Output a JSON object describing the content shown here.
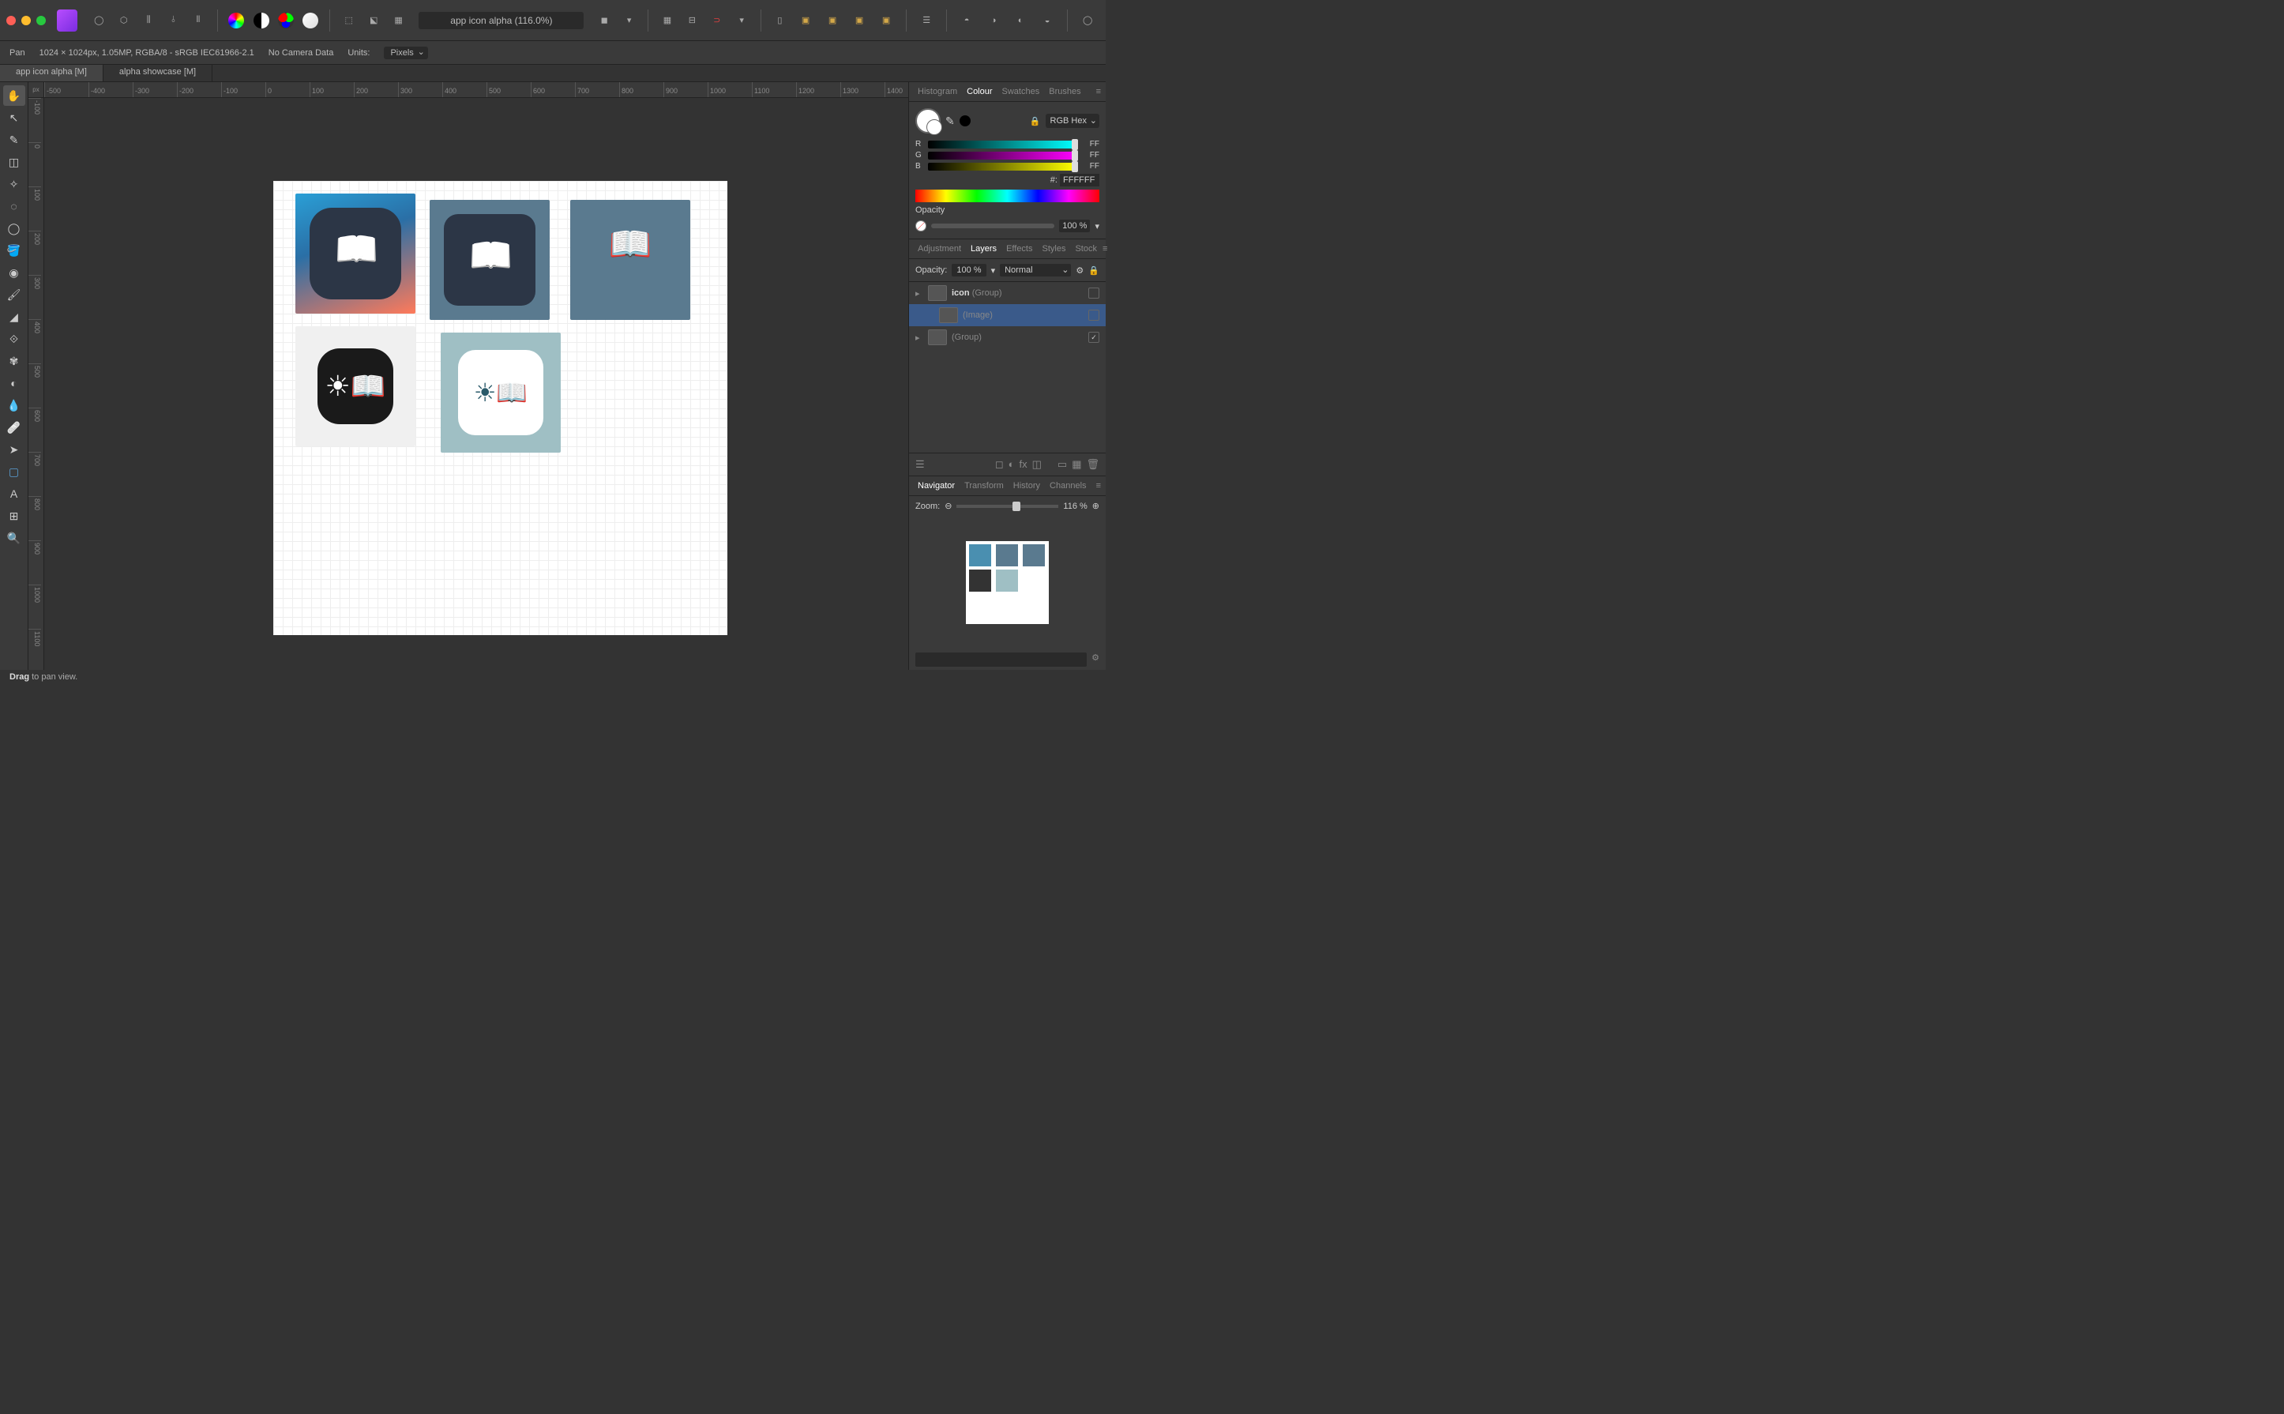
{
  "titlebar": {
    "doc_title": "app icon alpha (116.0%)"
  },
  "contextbar": {
    "tool": "Pan",
    "doc_info": "1024 × 1024px, 1.05MP, RGBA/8 - sRGB IEC61966-2.1",
    "camera": "No Camera Data",
    "units_label": "Units:",
    "units_value": "Pixels"
  },
  "doctabs": [
    "app icon alpha [M]",
    "alpha showcase [M]"
  ],
  "ruler_corner": "px",
  "ruler_h": [
    "-500",
    "-400",
    "-300",
    "-200",
    "-100",
    "0",
    "100",
    "200",
    "300",
    "400",
    "500",
    "600",
    "700",
    "800",
    "900",
    "1000",
    "1100",
    "1200",
    "1300",
    "1400"
  ],
  "ruler_v": [
    "-100",
    "0",
    "100",
    "200",
    "300",
    "400",
    "500",
    "600",
    "700",
    "800",
    "900",
    "1000",
    "1100"
  ],
  "colour_panel": {
    "tabs": [
      "Histogram",
      "Colour",
      "Swatches",
      "Brushes"
    ],
    "active_tab": "Colour",
    "format": "RGB Hex",
    "r_label": "R",
    "r_value": "FF",
    "g_label": "G",
    "g_value": "FF",
    "b_label": "B",
    "b_value": "FF",
    "hex_label": "#:",
    "hex_value": "FFFFFF",
    "opacity_label": "Opacity",
    "opacity_value": "100 %"
  },
  "layers_panel": {
    "tabs": [
      "Adjustment",
      "Layers",
      "Effects",
      "Styles",
      "Stock"
    ],
    "active_tab": "Layers",
    "opacity_label": "Opacity:",
    "opacity_value": "100 %",
    "blend_mode": "Normal",
    "layers": [
      {
        "name": "icon",
        "suffix": "(Group)",
        "expanded": false,
        "selected": false,
        "visible": false,
        "indent": 0
      },
      {
        "name": "",
        "suffix": "(Image)",
        "expanded": false,
        "selected": true,
        "visible": false,
        "indent": 1
      },
      {
        "name": "",
        "suffix": "(Group)",
        "expanded": false,
        "selected": false,
        "visible": true,
        "indent": 0
      }
    ]
  },
  "nav_panel": {
    "tabs": [
      "Navigator",
      "Transform",
      "History",
      "Channels"
    ],
    "active_tab": "Navigator",
    "zoom_label": "Zoom:",
    "zoom_value": "116 %"
  },
  "statusbar": {
    "bold": "Drag",
    "rest": " to pan view."
  }
}
